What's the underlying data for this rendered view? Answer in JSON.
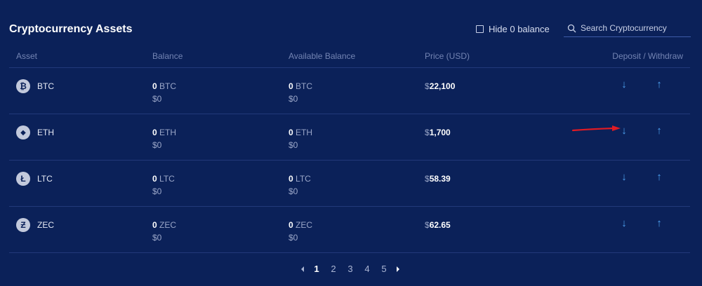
{
  "title": "Cryptocurrency Assets",
  "hide_zero_label": "Hide 0 balance",
  "search": {
    "placeholder": "Search Cryptocurrency"
  },
  "columns": {
    "asset": "Asset",
    "balance": "Balance",
    "available": "Available Balance",
    "price": "Price (USD)",
    "deposit_withdraw": "Deposit / Withdraw"
  },
  "rows": [
    {
      "symbol": "BTC",
      "icon": "bitcoin-icon",
      "glyph": "₿",
      "balance": "0",
      "balance_usd": "$0",
      "available": "0",
      "available_usd": "$0",
      "price_currency": "$",
      "price": "22,100"
    },
    {
      "symbol": "ETH",
      "icon": "ethereum-icon",
      "glyph": "◆",
      "balance": "0",
      "balance_usd": "$0",
      "available": "0",
      "available_usd": "$0",
      "price_currency": "$",
      "price": "1,700"
    },
    {
      "symbol": "LTC",
      "icon": "litecoin-icon",
      "glyph": "Ł",
      "balance": "0",
      "balance_usd": "$0",
      "available": "0",
      "available_usd": "$0",
      "price_currency": "$",
      "price": "58.39"
    },
    {
      "symbol": "ZEC",
      "icon": "zcash-icon",
      "glyph": "Ƶ",
      "balance": "0",
      "balance_usd": "$0",
      "available": "0",
      "available_usd": "$0",
      "price_currency": "$",
      "price": "62.65"
    }
  ],
  "pagination": {
    "pages": [
      "1",
      "2",
      "3",
      "4",
      "5"
    ],
    "current": "1"
  },
  "colors": {
    "background": "#0b2159",
    "accent": "#4ea2f2",
    "annotation": "#e01b24"
  }
}
